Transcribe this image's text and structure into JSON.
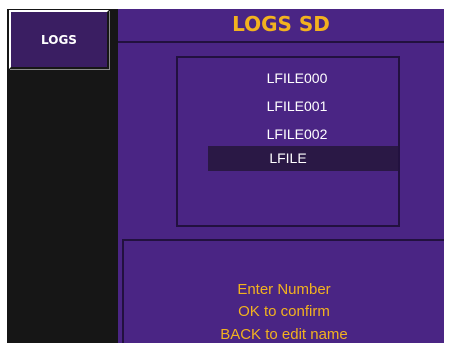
{
  "sidebar": {
    "tab_label": "LOGS"
  },
  "header": {
    "title": "LOGS SD"
  },
  "file_list": {
    "items": [
      "LFILE000",
      "LFILE001",
      "LFILE002"
    ],
    "edit_value": "LFILE"
  },
  "message": {
    "lines": [
      "Enter Number",
      "OK to confirm",
      "BACK to edit name"
    ]
  },
  "colors": {
    "background_main": "#4a2584",
    "accent_text": "#f2b21f",
    "sidebar": "#161616",
    "edit_row": "#2a1845"
  }
}
